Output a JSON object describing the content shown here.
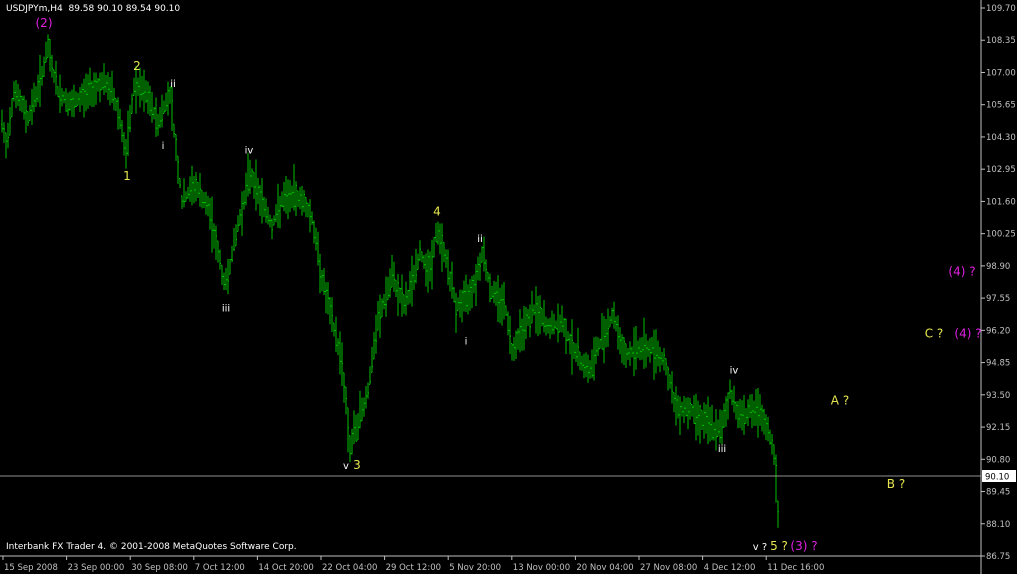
{
  "header": {
    "symbol_tf": "USDJPYm,H4",
    "ohlc": "89.58 90.10 89.54 90.10"
  },
  "footer": {
    "copyright": "Interbank FX Trader 4. © 2001-2008 MetaQuotes Software Corp."
  },
  "colors": {
    "background": "#000000",
    "bars": "#00c000",
    "axis": "#c0c0c0",
    "wave_minor": "#ffffff",
    "wave_intermediate": "#e6e650",
    "wave_primary": "#e020e0",
    "price_line": "#c0c0c0"
  },
  "chart_data": {
    "type": "ohlc",
    "symbol": "USDJPYm",
    "timeframe": "H4",
    "ylim": [
      86.75,
      109.7
    ],
    "y_ticks": [
      109.7,
      108.35,
      107.0,
      105.65,
      104.3,
      102.95,
      101.6,
      100.25,
      98.9,
      97.55,
      96.2,
      94.85,
      93.5,
      92.15,
      90.8,
      89.45,
      88.1,
      86.75
    ],
    "x_ticks": [
      "15 Sep 2008",
      "23 Sep 00:00",
      "30 Sep 08:00",
      "7 Oct 12:00",
      "14 Oct 20:00",
      "22 Oct 04:00",
      "29 Oct 12:00",
      "5 Nov 20:00",
      "13 Nov 00:00",
      "20 Nov 04:00",
      "27 Nov 08:00",
      "4 Dec 12:00",
      "11 Dec 16:00"
    ],
    "current_price": "90.10",
    "price_path": [
      [
        0,
        105.3
      ],
      [
        6,
        103.9
      ],
      [
        14,
        106.3
      ],
      [
        28,
        105.1
      ],
      [
        40,
        106.6
      ],
      [
        48,
        108.0
      ],
      [
        58,
        106.2
      ],
      [
        72,
        105.6
      ],
      [
        90,
        106.3
      ],
      [
        102,
        106.6
      ],
      [
        112,
        106.2
      ],
      [
        120,
        105.1
      ],
      [
        126,
        103.5
      ],
      [
        134,
        106.4
      ],
      [
        146,
        106.1
      ],
      [
        158,
        104.9
      ],
      [
        170,
        106.2
      ],
      [
        175,
        104.2
      ],
      [
        182,
        101.6
      ],
      [
        195,
        102.3
      ],
      [
        210,
        101.1
      ],
      [
        225,
        98.0
      ],
      [
        238,
        100.6
      ],
      [
        250,
        102.8
      ],
      [
        262,
        101.6
      ],
      [
        272,
        100.6
      ],
      [
        282,
        101.6
      ],
      [
        295,
        101.9
      ],
      [
        304,
        101.6
      ],
      [
        312,
        100.9
      ],
      [
        322,
        98.4
      ],
      [
        332,
        96.6
      ],
      [
        342,
        94.9
      ],
      [
        350,
        91.3
      ],
      [
        360,
        92.6
      ],
      [
        368,
        93.7
      ],
      [
        378,
        96.6
      ],
      [
        392,
        98.4
      ],
      [
        405,
        97.2
      ],
      [
        420,
        99.4
      ],
      [
        430,
        98.7
      ],
      [
        437,
        100.4
      ],
      [
        446,
        99.2
      ],
      [
        456,
        97.2
      ],
      [
        466,
        97.5
      ],
      [
        476,
        98.4
      ],
      [
        483,
        99.6
      ],
      [
        490,
        97.9
      ],
      [
        505,
        97.3
      ],
      [
        512,
        95.4
      ],
      [
        522,
        96.3
      ],
      [
        535,
        97.1
      ],
      [
        548,
        96.3
      ],
      [
        562,
        96.5
      ],
      [
        575,
        95.3
      ],
      [
        590,
        94.5
      ],
      [
        600,
        95.7
      ],
      [
        613,
        96.9
      ],
      [
        625,
        95.1
      ],
      [
        640,
        95.5
      ],
      [
        655,
        95.4
      ],
      [
        665,
        94.9
      ],
      [
        675,
        93.0
      ],
      [
        690,
        92.9
      ],
      [
        705,
        92.4
      ],
      [
        720,
        91.9
      ],
      [
        730,
        93.6
      ],
      [
        740,
        92.6
      ],
      [
        752,
        92.9
      ],
      [
        760,
        92.6
      ],
      [
        768,
        92.0
      ],
      [
        775,
        90.9
      ],
      [
        778,
        88.3
      ]
    ],
    "wave_labels": [
      {
        "text": "(2)",
        "x": 44,
        "y": 108.9,
        "degree": "primary"
      },
      {
        "text": "2",
        "x": 137,
        "y": 107.1,
        "degree": "intermediate"
      },
      {
        "text": "ii",
        "x": 173,
        "y": 106.4,
        "degree": "minor"
      },
      {
        "text": "1",
        "x": 127,
        "y": 102.5,
        "degree": "intermediate"
      },
      {
        "text": "i",
        "x": 163,
        "y": 103.8,
        "degree": "minor"
      },
      {
        "text": "iv",
        "x": 249,
        "y": 103.6,
        "degree": "minor"
      },
      {
        "text": "iii",
        "x": 226,
        "y": 97.0,
        "degree": "minor"
      },
      {
        "text": "4",
        "x": 437,
        "y": 101.0,
        "degree": "intermediate"
      },
      {
        "text": "ii",
        "x": 480,
        "y": 99.9,
        "degree": "minor"
      },
      {
        "text": "i",
        "x": 466,
        "y": 95.6,
        "degree": "minor"
      },
      {
        "text": "v",
        "x": 346,
        "y": 90.4,
        "degree": "minor"
      },
      {
        "text": "3",
        "x": 357,
        "y": 90.4,
        "degree": "intermediate"
      },
      {
        "text": "iv",
        "x": 734,
        "y": 94.4,
        "degree": "minor"
      },
      {
        "text": "iii",
        "x": 722,
        "y": 91.1,
        "degree": "minor"
      },
      {
        "text": "A ?",
        "x": 840,
        "y": 93.1,
        "degree": "intermediate"
      },
      {
        "text": "B ?",
        "x": 896,
        "y": 89.6,
        "degree": "intermediate"
      },
      {
        "text": "(4) ?",
        "x": 962,
        "y": 98.5,
        "degree": "primary"
      },
      {
        "text": "C ?",
        "x": 934,
        "y": 95.9,
        "degree": "intermediate"
      },
      {
        "text": "(4) ?",
        "x": 968,
        "y": 95.9,
        "degree": "primary"
      },
      {
        "text": "v ?",
        "x": 760,
        "y": 87.0,
        "degree": "minor"
      },
      {
        "text": "5 ?",
        "x": 779,
        "y": 87.0,
        "degree": "intermediate"
      },
      {
        "text": "(3) ?",
        "x": 804,
        "y": 87.0,
        "degree": "primary"
      }
    ]
  }
}
